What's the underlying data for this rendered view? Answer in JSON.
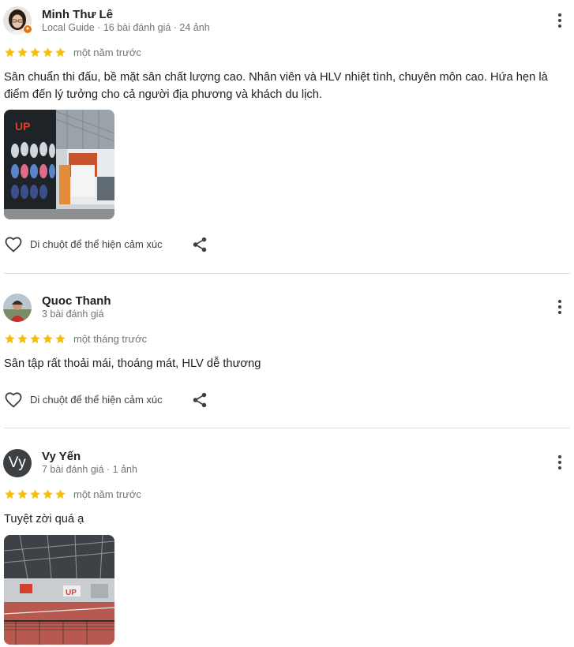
{
  "reviews": [
    {
      "name": "Minh Thư Lê",
      "meta": "Local Guide · 16 bài đánh giá · 24 ảnh",
      "rating": 5,
      "time": "một năm trước",
      "text": "Sân chuẩn thi đấu, bề mặt sân chất lượng cao. Nhân viên và HLV nhiệt tình, chuyên môn cao. Hứa hẹn là điểm đến lý tưởng cho cả người địa phương và khách du lịch.",
      "photo_sign_text": "UP",
      "like_label": "Di chuột để thể hiện cảm xúc"
    },
    {
      "name": "Quoc Thanh",
      "meta": "3 bài đánh giá",
      "rating": 5,
      "time": "một tháng trước",
      "text": "Sân tập rất thoải mái, thoáng mát, HLV dễ thương",
      "like_label": "Di chuột để thể hiện cảm xúc"
    },
    {
      "name": "Vy Yến",
      "avatar_initials": "Vy",
      "meta": "7 bài đánh giá · 1 ảnh",
      "rating": 5,
      "time": "một năm trước",
      "text": "Tuyệt zời quá ạ",
      "photo_sign_text": "UP"
    }
  ],
  "icons": {
    "star": "star-icon",
    "like": "heart-outline-icon",
    "share": "share-icon",
    "more": "more-vert-icon",
    "local_guide": "local-guide-badge-icon"
  },
  "colors": {
    "star": "#fbbc04",
    "meta": "#70757a",
    "divider": "#dadce0",
    "local_guide_badge": "#e8710a",
    "avatar_letter_bg": "#3c4043"
  }
}
